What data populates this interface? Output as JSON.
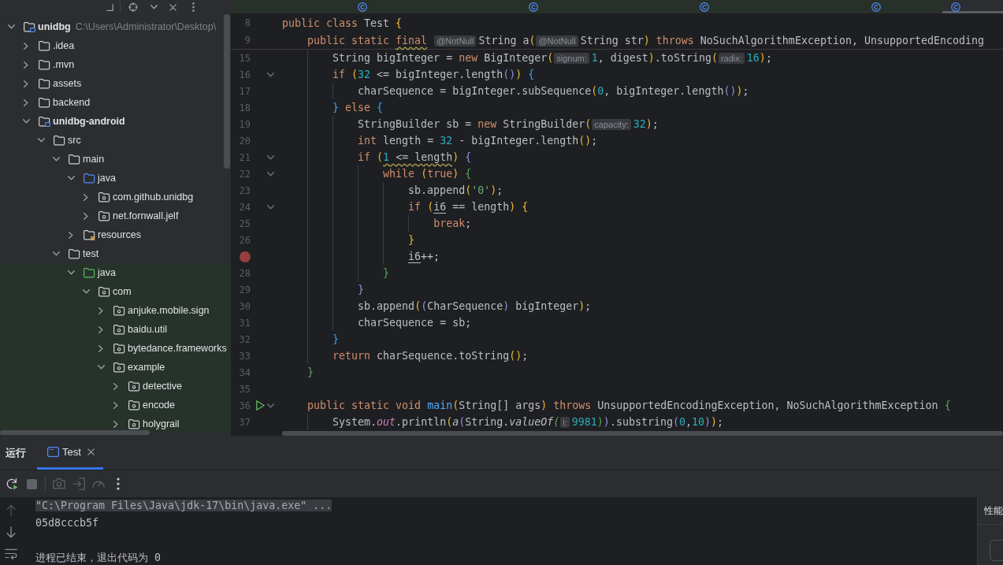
{
  "project_panel": {
    "tree": [
      {
        "name": "unidbg",
        "kind": "module",
        "path": "C:\\Users\\Administrator\\Desktop\\",
        "expanded": true,
        "children": [
          {
            "name": ".idea",
            "kind": "folder",
            "expanded": false
          },
          {
            "name": ".mvn",
            "kind": "folder",
            "expanded": false
          },
          {
            "name": "assets",
            "kind": "folder",
            "expanded": false
          },
          {
            "name": "backend",
            "kind": "folder",
            "expanded": false
          },
          {
            "name": "unidbg-android",
            "kind": "module",
            "expanded": true,
            "children": [
              {
                "name": "src",
                "kind": "folder",
                "expanded": true,
                "children": [
                  {
                    "name": "main",
                    "kind": "folder",
                    "expanded": true,
                    "children": [
                      {
                        "name": "java",
                        "kind": "source",
                        "expanded": true,
                        "children": [
                          {
                            "name": "com.github.unidbg",
                            "kind": "package",
                            "expanded": false
                          },
                          {
                            "name": "net.fornwall.jelf",
                            "kind": "package",
                            "expanded": false
                          }
                        ]
                      },
                      {
                        "name": "resources",
                        "kind": "resources",
                        "expanded": false
                      }
                    ]
                  },
                  {
                    "name": "test",
                    "kind": "folder",
                    "expanded": true,
                    "children": [
                      {
                        "name": "java",
                        "kind": "test",
                        "expanded": true,
                        "children": [
                          {
                            "name": "com",
                            "kind": "package",
                            "expanded": true,
                            "children": [
                              {
                                "name": "anjuke.mobile.sign",
                                "kind": "package",
                                "expanded": false
                              },
                              {
                                "name": "baidu.util",
                                "kind": "package",
                                "expanded": false
                              },
                              {
                                "name": "bytedance.frameworks",
                                "kind": "package",
                                "expanded": false
                              },
                              {
                                "name": "example",
                                "kind": "package",
                                "expanded": true,
                                "children": [
                                  {
                                    "name": "detective",
                                    "kind": "package",
                                    "expanded": false
                                  },
                                  {
                                    "name": "encode",
                                    "kind": "package",
                                    "expanded": false
                                  },
                                  {
                                    "name": "holygrail",
                                    "kind": "package",
                                    "expanded": false
                                  }
                                ]
                              }
                            ]
                          }
                        ]
                      }
                    ]
                  }
                ]
              }
            ]
          }
        ]
      }
    ]
  },
  "editor": {
    "tabs": [
      {
        "selected": false
      },
      {
        "selected": false
      },
      {
        "selected": false
      },
      {
        "selected": false
      },
      {
        "selected": false
      },
      {
        "selected": true
      }
    ],
    "sticky_lines": [
      {
        "kind": "code",
        "number": "8",
        "fold": false,
        "tokens": [
          {
            "text": "public class ",
            "kind": "keyword"
          },
          {
            "text": "Test {",
            "kind": "plain"
          }
        ]
      },
      {
        "kind": "code",
        "number": "9",
        "fold": false,
        "tokens": [
          {
            "text": "    public static ",
            "kind": "keyword"
          },
          {
            "text": "final ",
            "kind": "keyword",
            "wavy": true
          },
          {
            "text": "@NotNull",
            "kind": "hint"
          },
          {
            "text": "String a(",
            "kind": "plain"
          },
          {
            "text": "@NotNull",
            "kind": "hint"
          },
          {
            "text": "String str)",
            "kind": "plain"
          },
          {
            "text": " throws ",
            "kind": "keyword"
          },
          {
            "text": "NoSuchAlgorithmException, UnsupportedEncoding",
            "kind": "plain"
          }
        ]
      }
    ],
    "lines": [
      {
        "kind": "code",
        "number": "15",
        "fold": false,
        "tokens": [
          {
            "text": "        String bigInteger = ",
            "kind": "plain"
          },
          {
            "text": "new",
            "kind": "keyword"
          },
          {
            "text": " BigInteger(",
            "kind": "plain"
          },
          {
            "text": "signum:",
            "kind": "hint"
          },
          {
            "text": "1",
            "kind": "number"
          },
          {
            "text": ", digest).toString(",
            "kind": "plain"
          },
          {
            "text": "radix:",
            "kind": "hint"
          },
          {
            "text": "16",
            "kind": "number"
          },
          {
            "text": ");",
            "kind": "plain"
          }
        ]
      },
      {
        "kind": "code",
        "number": "16",
        "fold": true,
        "tokens": [
          {
            "text": "        if",
            "kind": "keyword"
          },
          {
            "text": " (",
            "kind": "plain"
          },
          {
            "text": "32",
            "kind": "number"
          },
          {
            "text": " <= bigInteger.length()) {",
            "kind": "plain"
          }
        ]
      },
      {
        "kind": "code",
        "number": "17",
        "fold": false,
        "tokens": [
          {
            "text": "            charSequence = bigInteger.subSequence(",
            "kind": "plain"
          },
          {
            "text": "0",
            "kind": "number"
          },
          {
            "text": ", bigInteger.length());",
            "kind": "plain"
          }
        ]
      },
      {
        "kind": "code",
        "number": "18",
        "fold": false,
        "tokens": [
          {
            "text": "        } ",
            "kind": "plain"
          },
          {
            "text": "else",
            "kind": "keyword"
          },
          {
            "text": " {",
            "kind": "plain"
          }
        ]
      },
      {
        "kind": "code",
        "number": "19",
        "fold": false,
        "tokens": [
          {
            "text": "            StringBuilder sb = ",
            "kind": "plain"
          },
          {
            "text": "new",
            "kind": "keyword"
          },
          {
            "text": " StringBuilder(",
            "kind": "plain"
          },
          {
            "text": "capacity:",
            "kind": "hint"
          },
          {
            "text": "32",
            "kind": "number"
          },
          {
            "text": ");",
            "kind": "plain"
          }
        ]
      },
      {
        "kind": "code",
        "number": "20",
        "fold": false,
        "tokens": [
          {
            "text": "            int",
            "kind": "keyword"
          },
          {
            "text": " length = ",
            "kind": "plain"
          },
          {
            "text": "32",
            "kind": "number"
          },
          {
            "text": " - bigInteger.length();",
            "kind": "plain"
          }
        ]
      },
      {
        "kind": "code",
        "number": "21",
        "fold": true,
        "tokens": [
          {
            "text": "            if",
            "kind": "keyword"
          },
          {
            "text": " (",
            "kind": "plain"
          },
          {
            "text": "1",
            "kind": "number",
            "wavy": true
          },
          {
            "text": " <= length",
            "kind": "plain",
            "wavy": true
          },
          {
            "text": ") {",
            "kind": "plain"
          }
        ]
      },
      {
        "kind": "code",
        "number": "22",
        "fold": true,
        "tokens": [
          {
            "text": "                while",
            "kind": "keyword"
          },
          {
            "text": " (",
            "kind": "plain"
          },
          {
            "text": "true",
            "kind": "keyword"
          },
          {
            "text": ") {",
            "kind": "plain"
          }
        ]
      },
      {
        "kind": "code",
        "number": "23",
        "fold": false,
        "tokens": [
          {
            "text": "                    sb.append(",
            "kind": "plain"
          },
          {
            "text": "'0'",
            "kind": "string"
          },
          {
            "text": ");",
            "kind": "plain"
          }
        ]
      },
      {
        "kind": "code",
        "number": "24",
        "fold": true,
        "tokens": [
          {
            "text": "                    if",
            "kind": "keyword"
          },
          {
            "text": " (",
            "kind": "plain"
          },
          {
            "text": "i6",
            "kind": "var"
          },
          {
            "text": " == length) {",
            "kind": "plain"
          }
        ]
      },
      {
        "kind": "code",
        "number": "25",
        "fold": false,
        "tokens": [
          {
            "text": "                        break",
            "kind": "keyword"
          },
          {
            "text": ";",
            "kind": "plain"
          }
        ]
      },
      {
        "kind": "code",
        "number": "26",
        "fold": false,
        "tokens": [
          {
            "text": "                    }",
            "kind": "plain"
          }
        ]
      },
      {
        "kind": "breakpoint",
        "fold": false,
        "tokens": [
          {
            "text": "                    i6",
            "kind": "var"
          },
          {
            "text": "++;",
            "kind": "plain"
          }
        ]
      },
      {
        "kind": "code",
        "number": "28",
        "fold": false,
        "tokens": [
          {
            "text": "                }",
            "kind": "plain"
          }
        ]
      },
      {
        "kind": "code",
        "number": "29",
        "fold": false,
        "tokens": [
          {
            "text": "            }",
            "kind": "plain"
          }
        ]
      },
      {
        "kind": "code",
        "number": "30",
        "fold": false,
        "tokens": [
          {
            "text": "            sb.append((CharSequence) bigInteger);",
            "kind": "plain"
          }
        ]
      },
      {
        "kind": "code",
        "number": "31",
        "fold": false,
        "tokens": [
          {
            "text": "            charSequence = sb;",
            "kind": "plain"
          }
        ]
      },
      {
        "kind": "code",
        "number": "32",
        "fold": false,
        "tokens": [
          {
            "text": "        }",
            "kind": "plain"
          }
        ]
      },
      {
        "kind": "code",
        "number": "33",
        "fold": false,
        "tokens": [
          {
            "text": "        return",
            "kind": "keyword"
          },
          {
            "text": " charSequence.toString();",
            "kind": "plain"
          }
        ]
      },
      {
        "kind": "code",
        "number": "34",
        "fold": false,
        "tokens": [
          {
            "text": "    }",
            "kind": "plain"
          }
        ]
      },
      {
        "kind": "code",
        "number": "35",
        "fold": false
      },
      {
        "kind": "run",
        "number": "36",
        "fold": true,
        "tokens": [
          {
            "text": "    public static void ",
            "kind": "keyword"
          },
          {
            "text": "main",
            "kind": "method"
          },
          {
            "text": "(String[] args)",
            "kind": "plain"
          },
          {
            "text": " throws ",
            "kind": "keyword"
          },
          {
            "text": "UnsupportedEncodingException, NoSuchAlgorithmException {",
            "kind": "plain"
          }
        ]
      },
      {
        "kind": "code",
        "number": "37",
        "fold": false,
        "tokens": [
          {
            "text": "        System.",
            "kind": "plain"
          },
          {
            "text": "out",
            "kind": "field"
          },
          {
            "text": ".println(",
            "kind": "plain"
          },
          {
            "text": "a",
            "kind": "call"
          },
          {
            "text": "(String.",
            "kind": "plain"
          },
          {
            "text": "valueOf(",
            "kind": "call"
          },
          {
            "text": "i:",
            "kind": "hint"
          },
          {
            "text": "9981",
            "kind": "number"
          },
          {
            "text": ")).substring(",
            "kind": "plain"
          },
          {
            "text": "0",
            "kind": "number"
          },
          {
            "text": ",",
            "kind": "plain"
          },
          {
            "text": "10",
            "kind": "number"
          },
          {
            "text": "));",
            "kind": "plain"
          }
        ]
      }
    ]
  },
  "run_panel": {
    "title": "运行",
    "tabs": [
      {
        "label": "Test",
        "selected": true
      }
    ],
    "toolbar": [
      {
        "kind": "rerun",
        "disabled": false
      },
      {
        "kind": "stop",
        "disabled": true
      },
      {
        "kind": "camera",
        "disabled": true
      },
      {
        "kind": "enter",
        "disabled": true
      },
      {
        "kind": "gauge",
        "disabled": true
      },
      {
        "kind": "more",
        "disabled": false
      }
    ],
    "scroll_controls": [
      {
        "kind": "up",
        "disabled": true
      },
      {
        "kind": "down",
        "disabled": false
      },
      {
        "kind": "wrap",
        "disabled": false
      }
    ],
    "console": [
      {
        "kind": "command",
        "text": "\"C:\\Program Files\\Java\\jdk-17\\bin\\java.exe\" ..."
      },
      {
        "kind": "output",
        "text": "05d8cccb5f"
      },
      {
        "kind": "exit",
        "text": "进程已结束，退出代码为 0"
      }
    ],
    "side_panel": {
      "title": "性能"
    }
  }
}
